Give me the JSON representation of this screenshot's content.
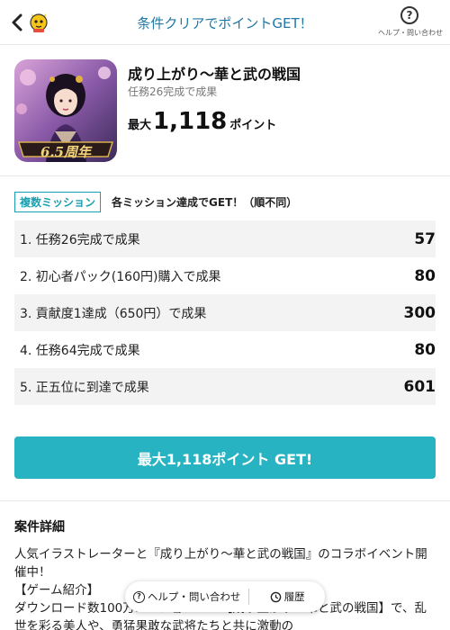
{
  "header": {
    "title": "条件クリアでポイントGET！",
    "help_label": "ヘルプ・問い合わせ",
    "help_symbol": "?"
  },
  "campaign": {
    "title": "成り上がり〜華と武の戦国",
    "subtitle": "任務26完成で成果",
    "points_prefix": "最大",
    "points_value": "1,118",
    "points_unit": "ポイント",
    "thumbnail_badge": "6.5周年"
  },
  "missions": {
    "badge": "複数ミッション",
    "note": "各ミッション達成でGET！（順不同）",
    "items": [
      {
        "label": "1. 任務26完成で成果",
        "value": "57"
      },
      {
        "label": "2. 初心者パック(160円)購入で成果",
        "value": "80"
      },
      {
        "label": "3. 貢献度1達成（650円）で成果",
        "value": "300"
      },
      {
        "label": "4. 任務64完成で成果",
        "value": "80"
      },
      {
        "label": "5. 正五位に到達で成果",
        "value": "601"
      }
    ]
  },
  "cta": {
    "label": "最大1,118ポイント GET!"
  },
  "details": {
    "title": "案件詳細",
    "line1": "人気イラストレーターと『成り上がり〜華と武の戦国』のコラボイベント開催中！",
    "line2": "【ゲーム紹介】",
    "line3": "ダウンロード数100万…ーションRPG【成り上がり〜華と武の戦国】で、乱世を彩る美人や、勇猛果敢な武将たちと共に激動の"
  },
  "floating_bar": {
    "help_label": "ヘルプ・問い合わせ",
    "history_label": "履歴"
  },
  "colors": {
    "accent": "#27b3c2",
    "header_title": "#1f78a8",
    "badge": "#1a9fb0"
  }
}
